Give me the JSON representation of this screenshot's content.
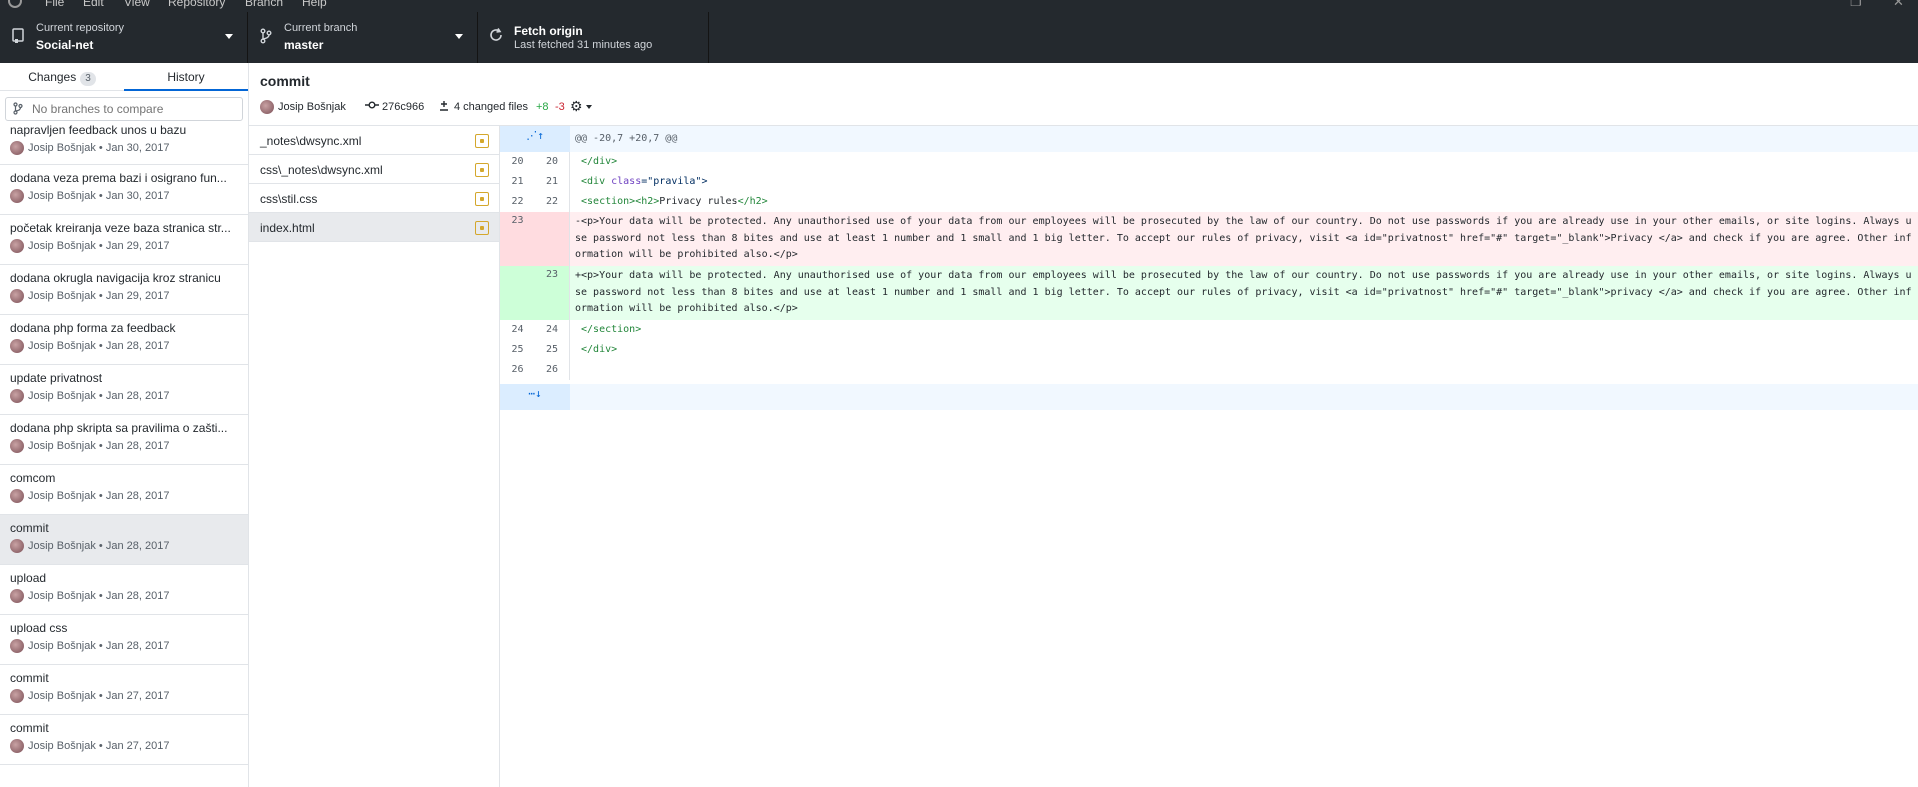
{
  "menu": {
    "items": [
      "File",
      "Edit",
      "View",
      "Repository",
      "Branch",
      "Help"
    ]
  },
  "toolbar": {
    "repo_label": "Current repository",
    "repo_value": "Social-net",
    "branch_label": "Current branch",
    "branch_value": "master",
    "fetch_label": "Fetch origin",
    "fetch_sub": "Last fetched 31 minutes ago"
  },
  "sidebar": {
    "tab_changes": "Changes",
    "changes_count": "3",
    "tab_history": "History",
    "compare_placeholder": "No branches to compare",
    "commits": [
      {
        "summary": "napravljen feedback unos u bazu",
        "meta": "Josip Bošnjak • Jan 30, 2017"
      },
      {
        "summary": "dodana veza prema bazi i osigrano fun...",
        "meta": "Josip Bošnjak • Jan 30, 2017"
      },
      {
        "summary": "početak kreiranja veze baza stranica str...",
        "meta": "Josip Bošnjak • Jan 29, 2017"
      },
      {
        "summary": "dodana okrugla navigacija kroz stranicu",
        "meta": "Josip Bošnjak • Jan 29, 2017"
      },
      {
        "summary": "dodana php forma za feedback",
        "meta": "Josip Bošnjak • Jan 28, 2017"
      },
      {
        "summary": "update privatnost",
        "meta": "Josip Bošnjak • Jan 28, 2017"
      },
      {
        "summary": "dodana php skripta sa pravilima o zašti...",
        "meta": "Josip Bošnjak • Jan 28, 2017"
      },
      {
        "summary": "comcom",
        "meta": "Josip Bošnjak • Jan 28, 2017"
      },
      {
        "summary": "commit",
        "meta": "Josip Bošnjak • Jan 28, 2017"
      },
      {
        "summary": "upload",
        "meta": "Josip Bošnjak • Jan 28, 2017"
      },
      {
        "summary": "upload css",
        "meta": "Josip Bošnjak • Jan 28, 2017"
      },
      {
        "summary": "commit",
        "meta": "Josip Bošnjak • Jan 27, 2017"
      },
      {
        "summary": "commit",
        "meta": "Josip Bošnjak • Jan 27, 2017"
      }
    ]
  },
  "commit": {
    "title": "commit",
    "author": "Josip Bošnjak",
    "sha": "276c966",
    "files_changed": "4 changed files",
    "additions": "+8",
    "deletions": "-3"
  },
  "files": [
    {
      "path": "_notes\\dwsync.xml"
    },
    {
      "path": "css\\_notes\\dwsync.xml"
    },
    {
      "path": "css\\stil.css"
    },
    {
      "path": "index.html"
    }
  ],
  "diff": {
    "hunk_header": "@@ -20,7 +20,7 @@",
    "line_numbers": [
      "20",
      "21",
      "22",
      "23",
      "24",
      "25",
      "26"
    ],
    "ctx_20": " </div>",
    "ctx_21_a": " <div ",
    "ctx_21_b": "class",
    "ctx_21_c": "=\"pravila\">",
    "ctx_22_a": " <section><h2>",
    "ctx_22_b": "Privacy rules",
    "ctx_22_c": "</h2>",
    "del_line_1": "-<p>Your data will be protected. Any unauthorised use of your data from our employees will be prosecuted by the law of our country. Do not use passwords if you are already use in your other emails, or site logins. Always u",
    "del_line_2": "se password not less than 8 bites and use at least 1 number and 1 small and 1 big letter. To accept our rules of privacy, visit <a id=\"privatnost\" href=\"#\" target=\"_blank\">Privacy </a> and check if you are agree. Other inf",
    "del_line_3": "ormation will be prohibited also.</p>",
    "add_line_1": "+<p>Your data will be protected. Any unauthorised use of your data from our employees will be prosecuted by the law of our country. Do not use passwords if you are already use in your other emails, or site logins. Always u",
    "add_line_2": "se password not less than 8 bites and use at least 1 number and 1 small and 1 big letter. To accept our rules of privacy, visit <a id=\"privatnost\" href=\"#\" target=\"_blank\">privacy </a> and check if you are agree. Other inf",
    "add_line_3": "ormation will be prohibited also.</p>",
    "ctx_24": " </section>",
    "ctx_25": " </div>",
    "ctx_26": ""
  },
  "colors": {
    "toolbar_bg": "#24292e",
    "accent": "#0366d6",
    "added": "#28a745",
    "deleted": "#cb2431"
  }
}
